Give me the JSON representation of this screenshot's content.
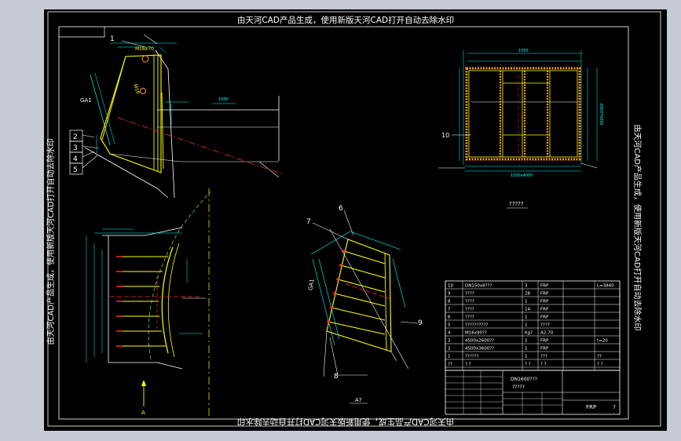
{
  "watermark": {
    "top": "由天河CAD产品生成，使用新版天河CAD打开自动去除水印",
    "left": "由天河CAD产品生成，使用新版天河CAD打开自动去除水印",
    "right": "由天河CAD产品生成，使用新版天河CAD打开自动去除水印",
    "bottom": "由天河CAD产品生成，使用新版天河CAD打开自动去除水印"
  },
  "colors": {
    "outer_bg": "#c6cbd6",
    "canvas_bg": "#000000",
    "frame": "#ffffff",
    "yellow": "#ffff00",
    "cyan": "#00ffff",
    "red": "#ff2a2a",
    "orange": "#ff9a1a",
    "white": "#ffffff",
    "green": "#5ad23a"
  },
  "left_callouts": [
    "2",
    "3",
    "4",
    "5"
  ],
  "callouts": {
    "c1": "1",
    "c6": "6",
    "c7": "7",
    "c8": "8",
    "c9": "9",
    "c10": "10"
  },
  "labels": {
    "ga1": "GA1",
    "ga2": "GA1",
    "m16": "M16x70",
    "bend_note": "1000x50",
    "m16b": "M16",
    "dim_top_right": "1500",
    "dim_bottom_right": "1500x4000",
    "side_dim": "2000x2000",
    "view_label": "?????",
    "view_a": "A",
    "view_a2": "A?",
    "dim_right_1": "1000",
    "left_arrow_label": "A"
  },
  "parts_table": {
    "rows": [
      {
        "no": "10",
        "code": "DN150x8???",
        "qty": "3",
        "mat": "FRP",
        "note": "L=3840"
      },
      {
        "no": "9",
        "code": "????",
        "qty": "28",
        "mat": "FRP",
        "note": ""
      },
      {
        "no": "8",
        "code": "????",
        "qty": "1",
        "mat": "FRP",
        "note": ""
      },
      {
        "no": "7",
        "code": "????",
        "qty": "14",
        "mat": "FRP",
        "note": ""
      },
      {
        "no": "6",
        "code": "????",
        "qty": "1",
        "mat": "FRP",
        "note": ""
      },
      {
        "no": "5",
        "code": "??????????",
        "qty": "1",
        "mat": "????",
        "note": ""
      },
      {
        "no": "4",
        "code": "M16x90??",
        "qty": "Kg?",
        "mat": "A2-70",
        "note": ""
      },
      {
        "no": "3",
        "code": "4500x2600??",
        "qty": "1",
        "mat": "FRP",
        "note": "t=20"
      },
      {
        "no": "2",
        "code": "4500x3600??",
        "qty": "1",
        "mat": "FRP",
        "note": ""
      },
      {
        "no": "1",
        "code": "??????",
        "qty": "1",
        "mat": "???",
        "note": "??"
      }
    ],
    "header": {
      "no": "??",
      "code": "? ?",
      "qty": "? ?",
      "mat": "? ?",
      "note": "? ?"
    }
  },
  "title_block": {
    "drawing_no": "DN1600???",
    "title": "?????",
    "material": "FRP",
    "sheet": "7"
  }
}
